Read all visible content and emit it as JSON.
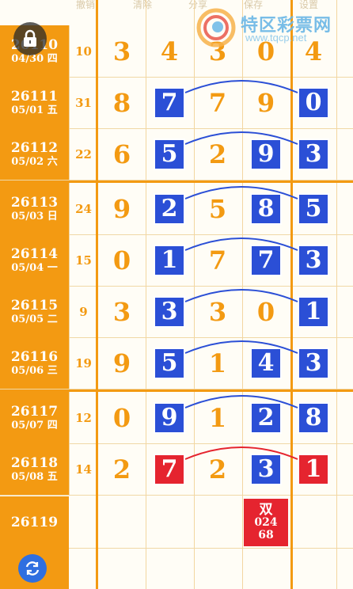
{
  "toolbar": {
    "undo": "撤销",
    "clear": "清除",
    "share": "分享",
    "save": "保存",
    "settings": "设置"
  },
  "watermark": {
    "name": "特区彩票网",
    "url": "www.tqcp.net"
  },
  "rows": [
    {
      "period": "26110",
      "date": "04/30 四",
      "sum": "10",
      "digits": [
        "3",
        "4",
        "3",
        "0",
        "4"
      ],
      "style": [
        "n",
        "n",
        "n",
        "n",
        "n"
      ]
    },
    {
      "period": "26111",
      "date": "05/01 五",
      "sum": "31",
      "digits": [
        "8",
        "7",
        "7",
        "9",
        "0"
      ],
      "style": [
        "n",
        "b",
        "n",
        "n",
        "b"
      ]
    },
    {
      "period": "26112",
      "date": "05/02 六",
      "sum": "22",
      "digits": [
        "6",
        "5",
        "2",
        "9",
        "3"
      ],
      "style": [
        "n",
        "b",
        "n",
        "b",
        "b"
      ]
    },
    {
      "period": "26113",
      "date": "05/03 日",
      "sum": "24",
      "digits": [
        "9",
        "2",
        "5",
        "8",
        "5"
      ],
      "style": [
        "n",
        "b",
        "n",
        "b",
        "b"
      ]
    },
    {
      "period": "26114",
      "date": "05/04 一",
      "sum": "15",
      "digits": [
        "0",
        "1",
        "7",
        "7",
        "3"
      ],
      "style": [
        "n",
        "b",
        "n",
        "b",
        "b"
      ]
    },
    {
      "period": "26115",
      "date": "05/05 二",
      "sum": "9",
      "digits": [
        "3",
        "3",
        "3",
        "0",
        "1"
      ],
      "style": [
        "n",
        "b",
        "n",
        "n",
        "b"
      ]
    },
    {
      "period": "26116",
      "date": "05/06 三",
      "sum": "19",
      "digits": [
        "9",
        "5",
        "1",
        "4",
        "3"
      ],
      "style": [
        "n",
        "b",
        "n",
        "b",
        "b"
      ]
    },
    {
      "period": "26117",
      "date": "05/07 四",
      "sum": "12",
      "digits": [
        "0",
        "9",
        "1",
        "2",
        "8"
      ],
      "style": [
        "n",
        "b",
        "n",
        "b",
        "b"
      ]
    },
    {
      "period": "26118",
      "date": "05/08 五",
      "sum": "14",
      "digits": [
        "2",
        "7",
        "2",
        "3",
        "1"
      ],
      "style": [
        "n",
        "r",
        "n",
        "b",
        "r"
      ]
    }
  ],
  "next_period": "26119",
  "prediction": {
    "line1": "双",
    "line2": "024",
    "line3": "68"
  },
  "colors": {
    "orange": "#f39a12",
    "blue": "#2b4fd6",
    "red": "#e5242f"
  },
  "icons": {
    "lock": "lock-icon",
    "refresh": "refresh-icon"
  }
}
